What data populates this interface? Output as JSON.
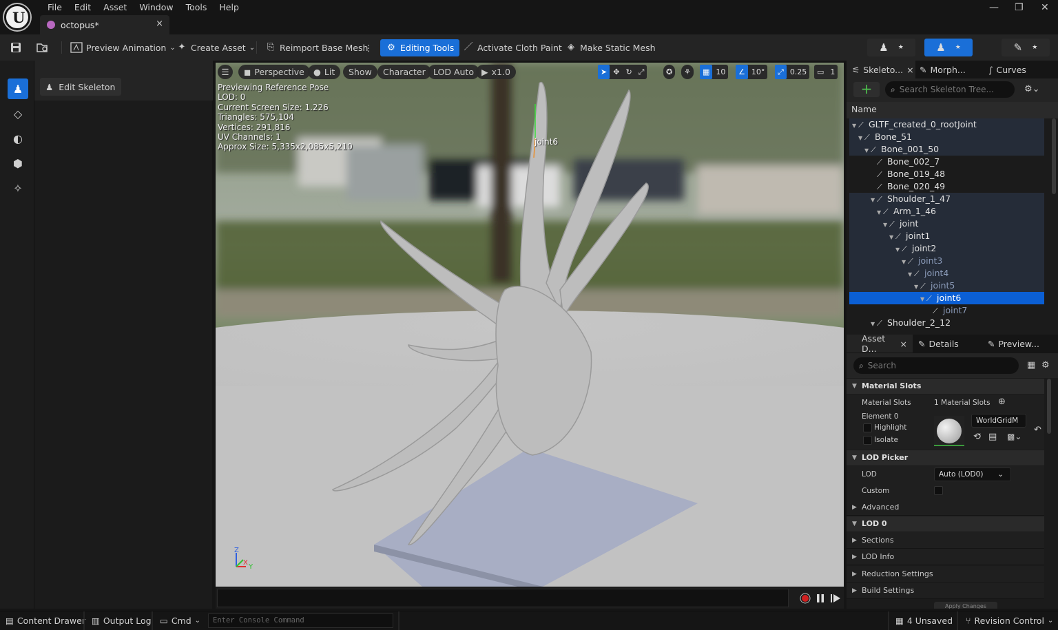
{
  "menu": [
    "File",
    "Edit",
    "Asset",
    "Window",
    "Tools",
    "Help"
  ],
  "tab": {
    "title": "octopus*",
    "close": "×"
  },
  "window_controls": {
    "minimize": "—",
    "restore": "❐",
    "close": "✕"
  },
  "toolbar": {
    "preview_animation": "Preview Animation",
    "create_asset": "Create Asset",
    "reimport": "Reimport Base Mesh",
    "editing_tools": "Editing Tools",
    "cloth_paint": "Activate Cloth Paint",
    "static_mesh": "Make Static Mesh"
  },
  "left_panel": {
    "edit_skeleton": "Edit Skeleton"
  },
  "viewport": {
    "perspective": "Perspective",
    "lit": "Lit",
    "show": "Show",
    "character": "Character",
    "lod": "LOD Auto",
    "speed": "x1.0",
    "grid_size": "10",
    "rot_snap": "10°",
    "scale_snap": "0.25",
    "camera_speed": "1",
    "stats": [
      "Previewing Reference Pose",
      "LOD: 0",
      "Current Screen Size: 1.226",
      "Triangles: 575,104",
      "Vertices: 291,816",
      "UV Channels: 1",
      "Approx Size: 5,335x2,085x5,210"
    ],
    "bone_label": "joint6",
    "axes": {
      "z": "Z",
      "x": "X",
      "y": "Y"
    }
  },
  "console": {
    "placeholder": "Enter Console Command"
  },
  "skeleton_panel": {
    "tabs": [
      "Skeleto...",
      "Morph...",
      "Curves"
    ],
    "close": "×",
    "search_placeholder": "Search Skeleton Tree...",
    "column": "Name",
    "bones": [
      {
        "name": "GLTF_created_0_rootJoint",
        "depth": 0,
        "state": "hl",
        "arrow": "▼"
      },
      {
        "name": "Bone_51",
        "depth": 1,
        "state": "hl",
        "arrow": "▼"
      },
      {
        "name": "Bone_001_50",
        "depth": 2,
        "state": "hl",
        "arrow": "▼"
      },
      {
        "name": "Bone_002_7",
        "depth": 3,
        "state": "",
        "arrow": ""
      },
      {
        "name": "Bone_019_48",
        "depth": 3,
        "state": "",
        "arrow": ""
      },
      {
        "name": "Bone_020_49",
        "depth": 3,
        "state": "",
        "arrow": ""
      },
      {
        "name": "Shoulder_1_47",
        "depth": 3,
        "state": "hl",
        "arrow": "▼"
      },
      {
        "name": "Arm_1_46",
        "depth": 4,
        "state": "hl",
        "arrow": "▼"
      },
      {
        "name": "joint",
        "depth": 5,
        "state": "hl",
        "arrow": "▼"
      },
      {
        "name": "joint1",
        "depth": 6,
        "state": "hl",
        "arrow": "▼"
      },
      {
        "name": "joint2",
        "depth": 7,
        "state": "hl",
        "arrow": "▼"
      },
      {
        "name": "joint3",
        "depth": 8,
        "state": "dimhl",
        "arrow": "▼"
      },
      {
        "name": "joint4",
        "depth": 9,
        "state": "dimhl",
        "arrow": "▼"
      },
      {
        "name": "joint5",
        "depth": 10,
        "state": "dimhl",
        "arrow": "▼"
      },
      {
        "name": "joint6",
        "depth": 11,
        "state": "sel",
        "arrow": "▼"
      },
      {
        "name": "joint7",
        "depth": 12,
        "state": "dim",
        "arrow": ""
      },
      {
        "name": "Shoulder_2_12",
        "depth": 3,
        "state": "",
        "arrow": "▼"
      }
    ]
  },
  "details_panel": {
    "tabs": [
      "Asset D...",
      "Details",
      "Preview..."
    ],
    "close": "×",
    "search_placeholder": "Search",
    "material_slots_section": "Material Slots",
    "material_slots_label": "Material Slots",
    "material_slots_value": "1 Material Slots",
    "element0": "Element 0",
    "highlight": "Highlight",
    "isolate": "Isolate",
    "material_name": "WorldGridM",
    "lod_picker_section": "LOD Picker",
    "lod_label": "LOD",
    "lod_value": "Auto (LOD0)",
    "custom_label": "Custom",
    "advanced": "Advanced",
    "lod0_section": "LOD 0",
    "sections": "Sections",
    "lod_info": "LOD Info",
    "reduction": "Reduction Settings",
    "build": "Build Settings",
    "apply": "Apply Changes"
  },
  "bottom_bar": {
    "content_drawer": "Content Drawer",
    "output_log": "Output Log",
    "cmd": "Cmd",
    "console_placeholder": "Enter Console Command",
    "unsaved": "4 Unsaved",
    "revision": "Revision Control"
  },
  "colors": {
    "accent": "#1a6fd8",
    "selected_row": "#0b5fd4",
    "add_green": "#4ec04e",
    "rec_red": "#d02020"
  }
}
